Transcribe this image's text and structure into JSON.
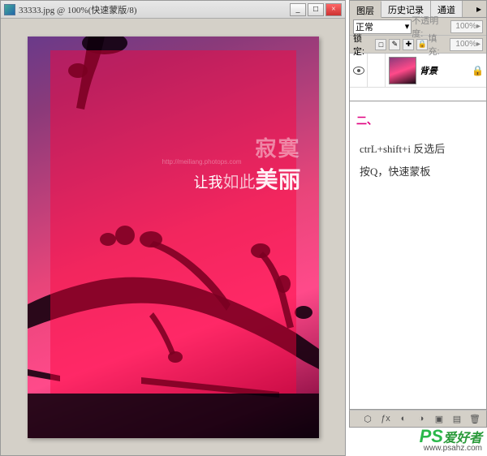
{
  "doc": {
    "filename": "33333.jpg",
    "zoom": "100%",
    "mode_label": "快速蒙版/8",
    "title_full": "33333.jpg @ 100%(快速蒙版/8)"
  },
  "window_buttons": {
    "min": "_",
    "max": "□",
    "close": "×"
  },
  "artwork": {
    "line1": "寂寞",
    "line2_a": "让我",
    "line2_b": "如此",
    "line2_c": "美",
    "line2_d": "丽",
    "url": "http://meiliang.photops.com"
  },
  "panels": {
    "tabs": [
      "图层",
      "历史记录",
      "通道"
    ],
    "active_tab": 0,
    "blend_mode": "正常",
    "opacity_label": "不透明度:",
    "opacity_value": "100%",
    "lock_label": "锁定:",
    "fill_label": "填充:",
    "fill_value": "100%",
    "layers": [
      {
        "name": "背景",
        "visible": true,
        "locked": true
      }
    ],
    "footer_icons": [
      "link",
      "fx",
      "mask",
      "adjust",
      "folder",
      "new",
      "trash"
    ]
  },
  "annotation": {
    "step": "二、",
    "line1": "ctrL+shift+i 反选后",
    "line2": "按Q，快速蒙板"
  },
  "watermark": {
    "brand_prefix": "PS",
    "brand_text": "爱好者",
    "url": "www.psahz.com"
  },
  "icons": {
    "dropdown": "▾",
    "menu": "▸",
    "checkbox": "□",
    "brush": "✎",
    "lock_t": "T",
    "lock_plus": "✚",
    "lock": "🔒",
    "link": "⬡",
    "fx": "ƒx",
    "mask": "◐",
    "adjust": "◑",
    "folder": "▣",
    "new": "▤",
    "trash": "🗑"
  }
}
